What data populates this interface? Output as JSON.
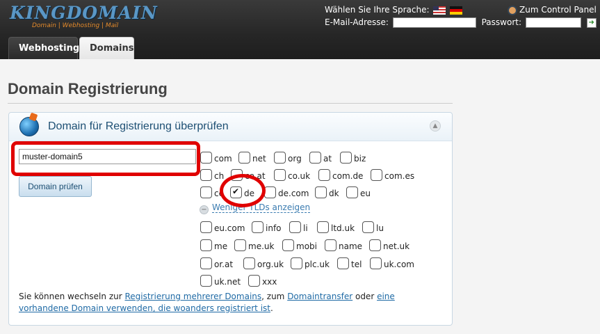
{
  "header": {
    "logo_text": "KINGDOMAIN",
    "logo_tagline": "Domain | Webhosting | Mail",
    "language_label": "Wählen Sie Ihre Sprache:",
    "control_panel_link": "Zum Control Panel",
    "email_label": "E-Mail-Adresse:",
    "password_label": "Passwort:",
    "email_value": "",
    "password_value": ""
  },
  "tabs": [
    {
      "label": "Webhosting"
    },
    {
      "label": "Domains"
    }
  ],
  "page": {
    "title": "Domain Registrierung"
  },
  "panel": {
    "title": "Domain für Registrierung überprüfen",
    "domain_input_value": "muster-domain5",
    "check_button": "Domain prüfen",
    "fewer_tlds_label": "Weniger TLDs anzeigen",
    "tlds_primary": [
      {
        "label": "com",
        "checked": false
      },
      {
        "label": "net",
        "checked": false
      },
      {
        "label": "org",
        "checked": false
      },
      {
        "label": "at",
        "checked": false
      },
      {
        "label": "biz",
        "checked": false
      },
      {
        "label": "ch",
        "checked": false
      },
      {
        "label": "co.at",
        "checked": false
      },
      {
        "label": "co.uk",
        "checked": false
      },
      {
        "label": "com.de",
        "checked": false
      },
      {
        "label": "com.es",
        "checked": false
      },
      {
        "label": "cc",
        "checked": false
      },
      {
        "label": "de",
        "checked": true
      },
      {
        "label": "de.com",
        "checked": false
      },
      {
        "label": "dk",
        "checked": false
      },
      {
        "label": "eu",
        "checked": false
      }
    ],
    "tlds_more": [
      {
        "label": "eu.com",
        "checked": false
      },
      {
        "label": "info",
        "checked": false
      },
      {
        "label": "li",
        "checked": false
      },
      {
        "label": "ltd.uk",
        "checked": false
      },
      {
        "label": "lu",
        "checked": false
      },
      {
        "label": "me",
        "checked": false
      },
      {
        "label": "me.uk",
        "checked": false
      },
      {
        "label": "mobi",
        "checked": false
      },
      {
        "label": "name",
        "checked": false
      },
      {
        "label": "net.uk",
        "checked": false
      },
      {
        "label": "or.at",
        "checked": false
      },
      {
        "label": "org.uk",
        "checked": false
      },
      {
        "label": "plc.uk",
        "checked": false
      },
      {
        "label": "tel",
        "checked": false
      },
      {
        "label": "uk.com",
        "checked": false
      },
      {
        "label": "uk.net",
        "checked": false
      },
      {
        "label": "xxx",
        "checked": false
      }
    ],
    "footer": {
      "text_1": "Sie können wechseln zur ",
      "link_multi": "Registrierung mehrerer Domains",
      "text_2": ", zum ",
      "link_transfer": "Domaintransfer",
      "text_3": " oder ",
      "link_existing": "eine vorhandene Domain verwenden, die woanders registriert ist",
      "text_4": "."
    }
  },
  "colors": {
    "annotation_red": "#e00000",
    "link_blue": "#1f6aa5",
    "panel_title_blue": "#1d4f73"
  }
}
